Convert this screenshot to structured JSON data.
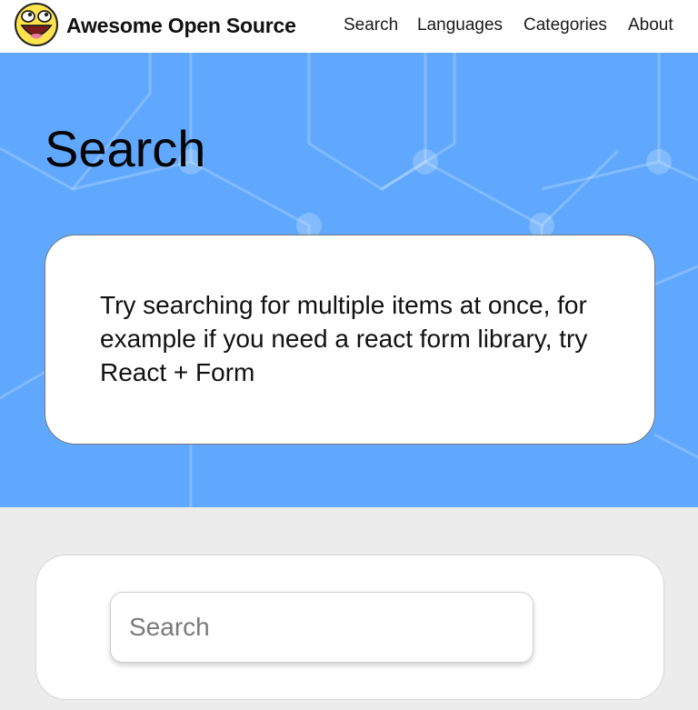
{
  "header": {
    "brand": "Awesome Open Source",
    "logo_icon": "awesome-smiley-face-icon",
    "nav": [
      {
        "label": "Search"
      },
      {
        "label": "Languages"
      },
      {
        "label": "Categories"
      },
      {
        "label": "About"
      }
    ]
  },
  "hero": {
    "title": "Search",
    "tip": "Try searching for multiple items at once, for example if you need a react form library, try React + Form",
    "background_color": "#5fa8fe"
  },
  "search": {
    "placeholder": "Search",
    "value": ""
  }
}
